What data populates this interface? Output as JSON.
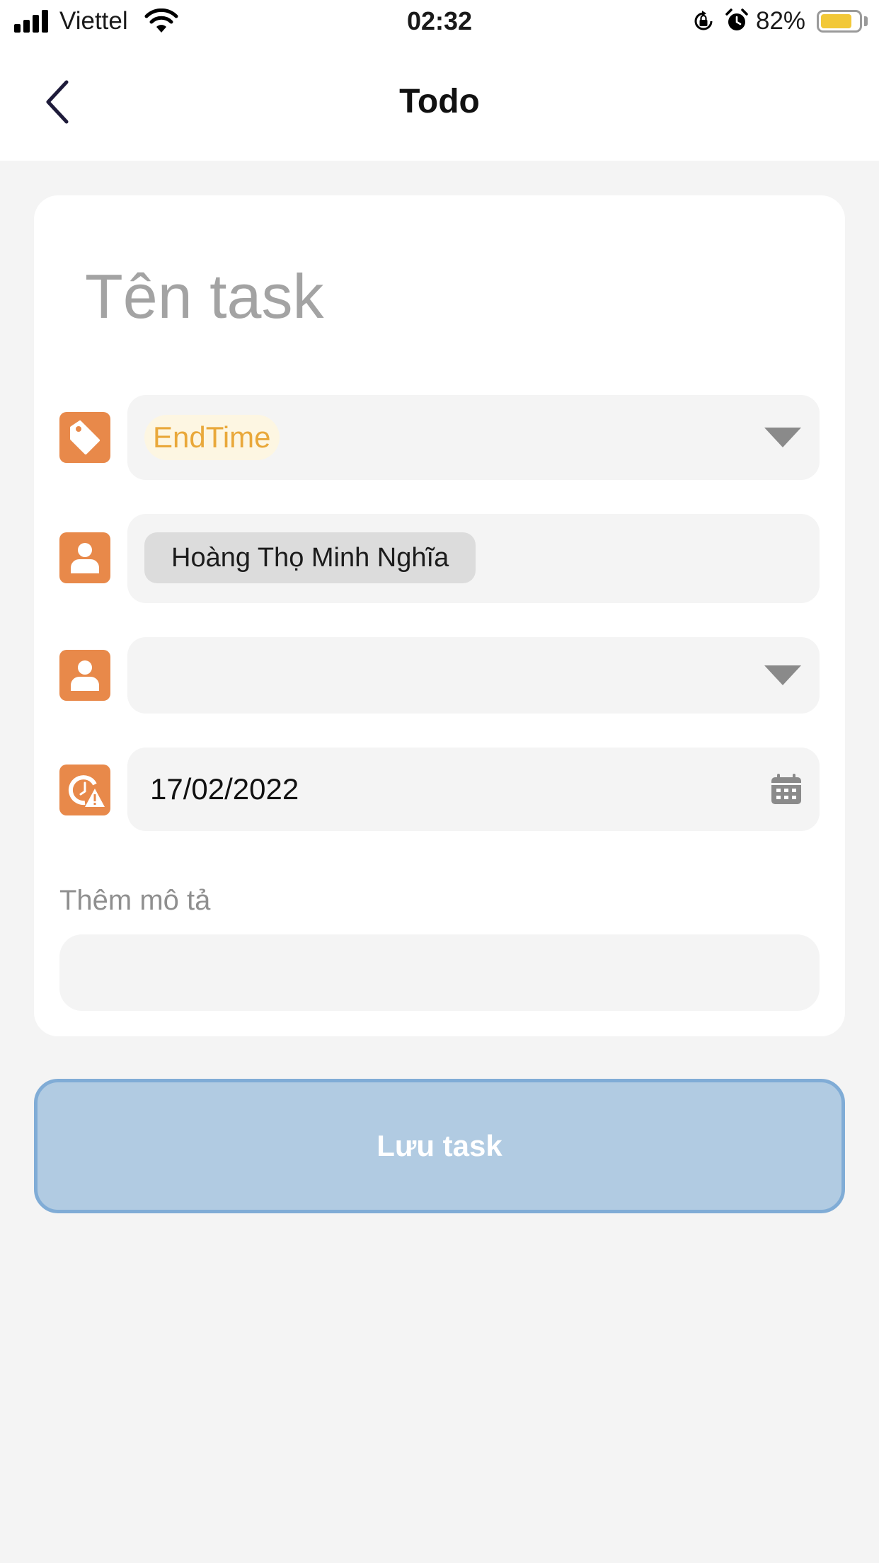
{
  "status_bar": {
    "carrier": "Viettel",
    "time": "02:32",
    "battery_percent": "82%",
    "battery_level": 0.82,
    "icons": [
      "signal-icon",
      "wifi-icon",
      "orientation-lock-icon",
      "alarm-icon",
      "battery-icon"
    ]
  },
  "header": {
    "title": "Todo",
    "back_icon": "chevron-left-icon"
  },
  "form": {
    "task_name_placeholder": "Tên task",
    "tag": {
      "icon": "tag-icon",
      "value": "EndTime",
      "dropdown_icon": "caret-down-icon"
    },
    "assignee": {
      "icon": "person-icon",
      "value": "Hoàng Thọ Minh Nghĩa"
    },
    "follower": {
      "icon": "person-icon",
      "value": "",
      "dropdown_icon": "caret-down-icon"
    },
    "deadline": {
      "icon": "deadline-clock-warning-icon",
      "value": "17/02/2022",
      "picker_icon": "calendar-icon"
    },
    "description_label": "Thêm mô tả",
    "description_value": ""
  },
  "save_button": {
    "label": "Lưu task"
  },
  "colors": {
    "accent_orange": "#e8894a",
    "tag_text": "#e9a83a",
    "tag_bg": "#fdf6e2",
    "button_bg": "#b1cbe2",
    "button_border": "#80acd6",
    "page_bg": "#f4f4f4"
  }
}
